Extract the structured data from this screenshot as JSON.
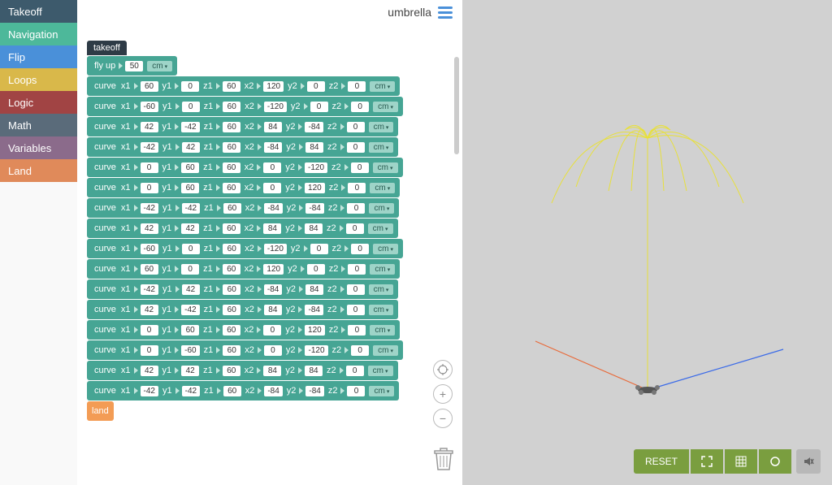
{
  "sidebar": {
    "categories": [
      {
        "label": "Takeoff",
        "color": "#3d5a6c"
      },
      {
        "label": "Navigation",
        "color": "#4db89a"
      },
      {
        "label": "Flip",
        "color": "#4a90d9"
      },
      {
        "label": "Loops",
        "color": "#d9b84a"
      },
      {
        "label": "Logic",
        "color": "#a14444"
      },
      {
        "label": "Math",
        "color": "#5a6b7a"
      },
      {
        "label": "Variables",
        "color": "#8b6b8b"
      },
      {
        "label": "Land",
        "color": "#e08a5a"
      }
    ]
  },
  "header": {
    "project_name": "umbrella"
  },
  "blocks": {
    "takeoff_label": "takeoff",
    "flyup_label": "fly up",
    "flyup_value": "50",
    "curve_label": "curve",
    "axis_labels": [
      "x1",
      "y1",
      "z1",
      "x2",
      "y2",
      "z2"
    ],
    "unit": "cm",
    "land_label": "land",
    "curves": [
      {
        "x1": "60",
        "y1": "0",
        "z1": "60",
        "x2": "120",
        "y2": "0",
        "z2": "0"
      },
      {
        "x1": "-60",
        "y1": "0",
        "z1": "60",
        "x2": "-120",
        "y2": "0",
        "z2": "0"
      },
      {
        "x1": "42",
        "y1": "-42",
        "z1": "60",
        "x2": "84",
        "y2": "-84",
        "z2": "0"
      },
      {
        "x1": "-42",
        "y1": "42",
        "z1": "60",
        "x2": "-84",
        "y2": "84",
        "z2": "0"
      },
      {
        "x1": "0",
        "y1": "60",
        "z1": "60",
        "x2": "0",
        "y2": "-120",
        "z2": "0"
      },
      {
        "x1": "0",
        "y1": "60",
        "z1": "60",
        "x2": "0",
        "y2": "120",
        "z2": "0"
      },
      {
        "x1": "-42",
        "y1": "-42",
        "z1": "60",
        "x2": "-84",
        "y2": "-84",
        "z2": "0"
      },
      {
        "x1": "42",
        "y1": "42",
        "z1": "60",
        "x2": "84",
        "y2": "84",
        "z2": "0"
      },
      {
        "x1": "-60",
        "y1": "0",
        "z1": "60",
        "x2": "-120",
        "y2": "0",
        "z2": "0"
      },
      {
        "x1": "60",
        "y1": "0",
        "z1": "60",
        "x2": "120",
        "y2": "0",
        "z2": "0"
      },
      {
        "x1": "-42",
        "y1": "42",
        "z1": "60",
        "x2": "-84",
        "y2": "84",
        "z2": "0"
      },
      {
        "x1": "42",
        "y1": "-42",
        "z1": "60",
        "x2": "84",
        "y2": "-84",
        "z2": "0"
      },
      {
        "x1": "0",
        "y1": "60",
        "z1": "60",
        "x2": "0",
        "y2": "120",
        "z2": "0"
      },
      {
        "x1": "0",
        "y1": "-60",
        "z1": "60",
        "x2": "0",
        "y2": "-120",
        "z2": "0"
      },
      {
        "x1": "42",
        "y1": "42",
        "z1": "60",
        "x2": "84",
        "y2": "84",
        "z2": "0"
      },
      {
        "x1": "-42",
        "y1": "-42",
        "z1": "60",
        "x2": "-84",
        "y2": "-84",
        "z2": "0"
      }
    ]
  },
  "viewer": {
    "toolbar": {
      "reset": "RESET"
    }
  }
}
